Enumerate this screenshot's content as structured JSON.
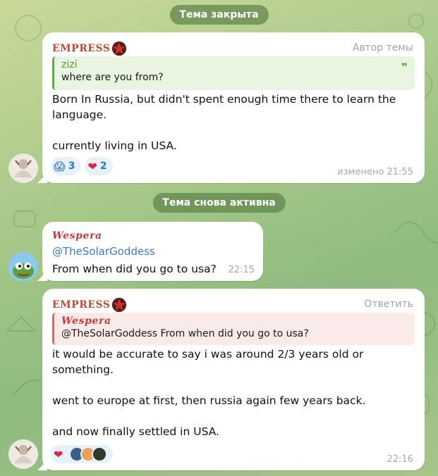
{
  "service": {
    "topic_closed": "Тема закрыта",
    "topic_reopened": "Тема снова активна"
  },
  "messages": [
    {
      "sender": "EMPRESS",
      "role": "Автор темы",
      "quote_name": "zizi",
      "quote_text": "where are you from?",
      "lines": [
        "Born In Russia, but didn't spent enough time there to learn the",
        "language.",
        "",
        "currently living in USA."
      ],
      "reactions": [
        {
          "emoji": "😱",
          "count": "3"
        },
        {
          "emoji": "❤",
          "count": "2"
        }
      ],
      "time": "изменено 21:55"
    },
    {
      "sender": "Wespera",
      "mention": "@TheSolarGoddess",
      "text": "From when did you go to usa?",
      "time": "22:15"
    },
    {
      "sender": "EMPRESS",
      "role": "Ответить",
      "quote_name": "Wespera",
      "quote_text": "@TheSolarGoddess From when did you go to usa?",
      "lines": [
        "it would be accurate to say i was around 2/3 years old or",
        "something.",
        "",
        "went to europe at first, then russia again few years back.",
        "",
        "and now finally settled in USA."
      ],
      "reactions": [
        {
          "emoji": "❤",
          "count": ""
        }
      ],
      "time": "22:16"
    }
  ],
  "colors": {
    "empress": "#c44a2f",
    "wespera": "#c53a3a",
    "link": "#3a7bbd",
    "quote_green": "#5daa46"
  },
  "icons": [
    "star-icon",
    "quote-mark-icon",
    "heart-icon",
    "shock-face-icon"
  ]
}
